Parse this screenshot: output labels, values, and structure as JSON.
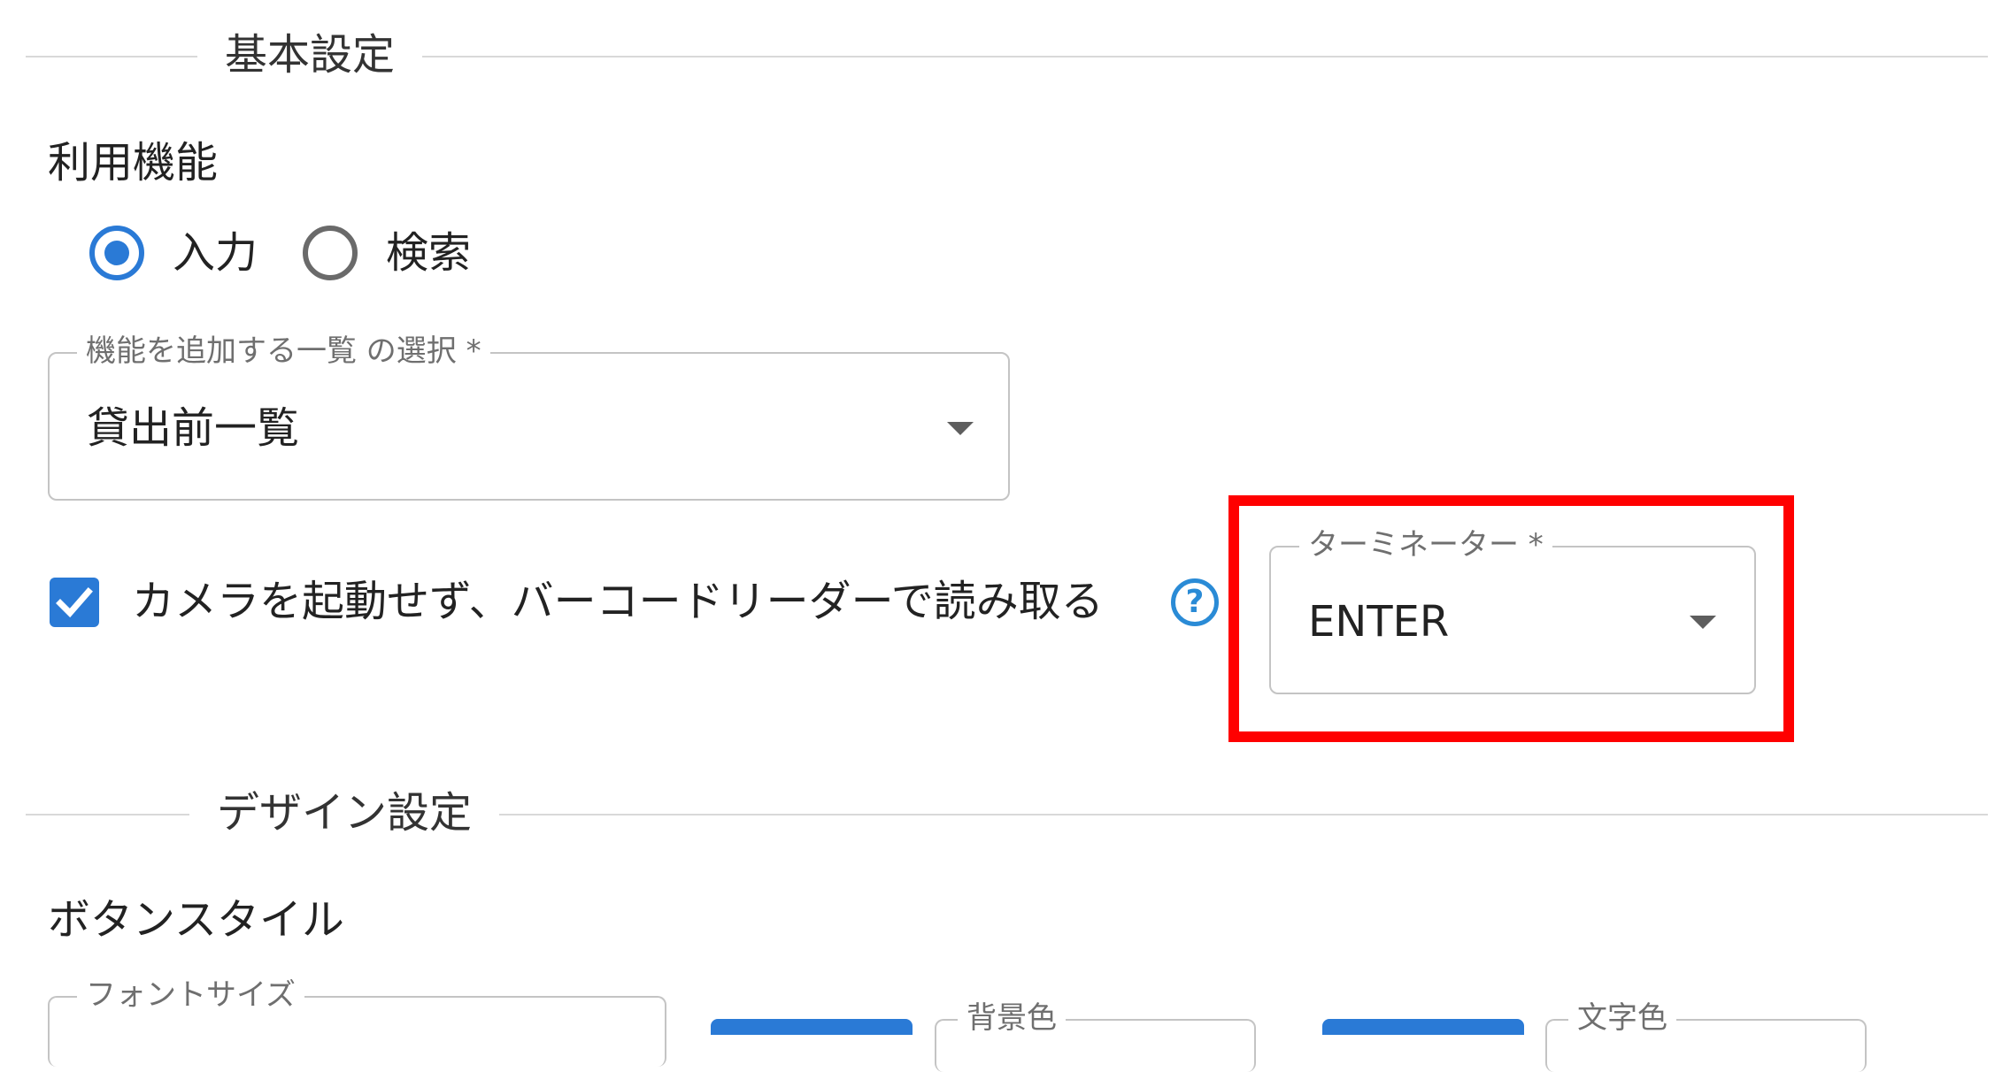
{
  "sections": {
    "basic": "基本設定",
    "design": "デザイン設定"
  },
  "feature": {
    "label": "利用機能",
    "options": [
      {
        "label": "入力",
        "selected": true
      },
      {
        "label": "検索",
        "selected": false
      }
    ]
  },
  "list_select": {
    "label": "機能を追加する一覧 の選択 *",
    "value": "貸出前一覧"
  },
  "barcode": {
    "checked": true,
    "label": "カメラを起動せず、バーコードリーダーで読み取る",
    "help_icon": "?"
  },
  "terminator": {
    "label": "ターミネーター *",
    "value": "ENTER"
  },
  "button_style": {
    "label": "ボタンスタイル",
    "font_size_label": "フォントサイズ",
    "bg_color_label": "背景色",
    "text_color_label": "文字色"
  },
  "colors": {
    "accent": "#2a7ad6",
    "highlight": "#ff0000"
  }
}
